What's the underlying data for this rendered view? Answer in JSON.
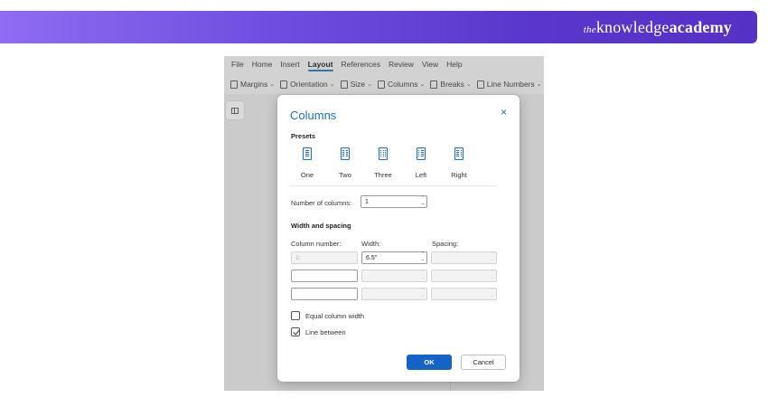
{
  "banner": {
    "brand_prefix": "the",
    "brand_main": "knowledge",
    "brand_bold": "academy",
    "colors": {
      "start": "#8f6cf2",
      "end": "#5531c4"
    }
  },
  "menubar": [
    "File",
    "Home",
    "Insert",
    "Layout",
    "References",
    "Review",
    "View",
    "Help"
  ],
  "menubar_active": "Layout",
  "toolbar": [
    "Margins",
    "Orientation",
    "Size",
    "Columns",
    "Breaks",
    "Line Numbers"
  ],
  "toolbar_icons": [
    "margins-icon",
    "orientation-icon",
    "size-icon",
    "columns-icon",
    "breaks-icon",
    "line-numbers-icon"
  ],
  "dialog": {
    "title": "Columns",
    "close": "×",
    "presets_heading": "Presets",
    "presets": [
      "One",
      "Two",
      "Three",
      "Left",
      "Right"
    ],
    "num_columns_label": "Number of columns:",
    "num_columns_value": "1",
    "width_spacing_heading": "Width and spacing",
    "col_headers": {
      "number": "Column number:",
      "width": "Width:",
      "spacing": "Spacing:"
    },
    "row1": {
      "number": "1:",
      "width": "6.5\""
    },
    "equal_width_label": "Equal column width",
    "equal_width_checked": false,
    "line_between_label": "Line between",
    "line_between_checked": true,
    "ok_label": "OK",
    "cancel_label": "Cancel",
    "accent_color": "#1663c7"
  }
}
